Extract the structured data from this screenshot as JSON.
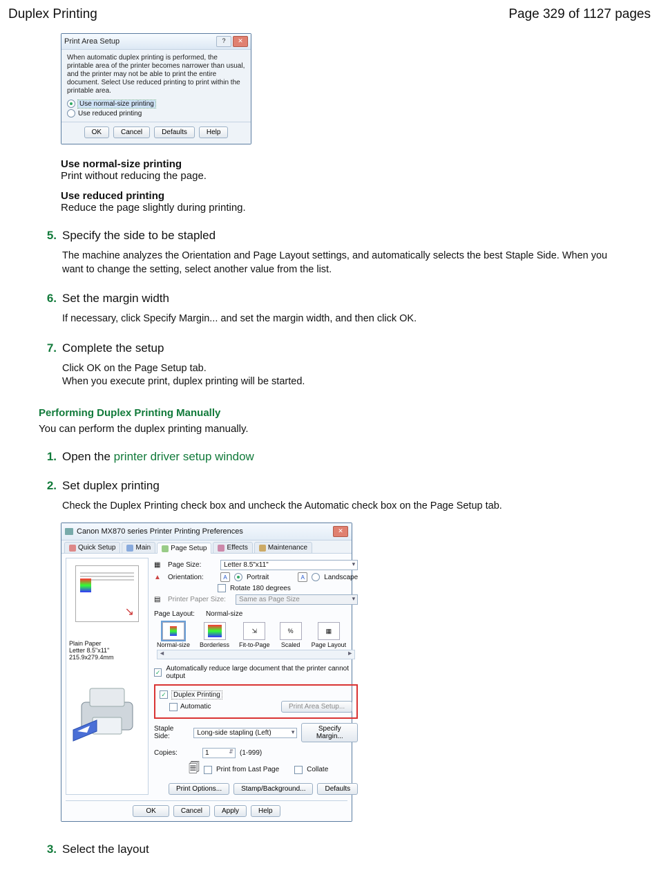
{
  "header": {
    "title": "Duplex Printing",
    "page": "Page 329 of 1127 pages"
  },
  "dialog1": {
    "title": "Print Area Setup",
    "description": "When automatic duplex printing is performed, the printable area of the printer becomes narrower than usual, and the printer may not be able to print the entire document. Select Use reduced printing to print within the printable area.",
    "radio_normal": "Use normal-size printing",
    "radio_reduced": "Use reduced printing",
    "btn_ok": "OK",
    "btn_cancel": "Cancel",
    "btn_defaults": "Defaults",
    "btn_help": "Help"
  },
  "options": {
    "normal_title": "Use normal-size printing",
    "normal_body": "Print without reducing the page.",
    "reduced_title": "Use reduced printing",
    "reduced_body": "Reduce the page slightly during printing."
  },
  "step5": {
    "num": "5.",
    "title": "Specify the side to be stapled",
    "body": "The machine analyzes the Orientation and Page Layout settings, and automatically selects the best Staple Side. When you want to change the setting, select another value from the list."
  },
  "step6": {
    "num": "6.",
    "title": "Set the margin width",
    "body": "If necessary, click Specify Margin... and set the margin width, and then click OK."
  },
  "step7": {
    "num": "7.",
    "title": "Complete the setup",
    "body1": "Click OK on the Page Setup tab.",
    "body2": "When you execute print, duplex printing will be started."
  },
  "section2": {
    "title": "Performing Duplex Printing Manually",
    "body": "You can perform the duplex printing manually."
  },
  "mstep1": {
    "num": "1.",
    "pre": "Open the ",
    "link": "printer driver setup window"
  },
  "mstep2": {
    "num": "2.",
    "title": "Set duplex printing",
    "body": "Check the Duplex Printing check box and uncheck the Automatic check box on the Page Setup tab."
  },
  "mstep3": {
    "num": "3.",
    "title": "Select the layout"
  },
  "dialog2": {
    "title": "Canon MX870 series Printer Printing Preferences",
    "tabs": {
      "quick": "Quick Setup",
      "main": "Main",
      "page": "Page Setup",
      "effects": "Effects",
      "maint": "Maintenance"
    },
    "page_size_label": "Page Size:",
    "page_size_value": "Letter 8.5\"x11\"",
    "orientation_label": "Orientation:",
    "portrait": "Portrait",
    "landscape": "Landscape",
    "rotate": "Rotate 180 degrees",
    "printer_paper_size_label": "Printer Paper Size:",
    "printer_paper_size_value": "Same as Page Size",
    "page_layout_label": "Page Layout:",
    "page_layout_value": "Normal-size",
    "layouts": [
      "Normal-size",
      "Borderless",
      "Fit-to-Page",
      "Scaled",
      "Page Layout"
    ],
    "auto_reduce": "Automatically reduce large document that the printer cannot output",
    "duplex_printing": "Duplex Printing",
    "automatic": "Automatic",
    "print_area_setup_btn": "Print Area Setup...",
    "staple_side_label": "Staple Side:",
    "staple_side_value": "Long-side stapling (Left)",
    "specify_margin_btn": "Specify Margin...",
    "copies_label": "Copies:",
    "copies_value": "1",
    "copies_range": "(1-999)",
    "print_last": "Print from Last Page",
    "collate": "Collate",
    "print_options_btn": "Print Options...",
    "stamp_btn": "Stamp/Background...",
    "defaults_btn": "Defaults",
    "ok": "OK",
    "cancel": "Cancel",
    "apply": "Apply",
    "help": "Help",
    "preview_media": "Plain Paper",
    "preview_size": "Letter 8.5\"x11\" 215.9x279.4mm"
  }
}
